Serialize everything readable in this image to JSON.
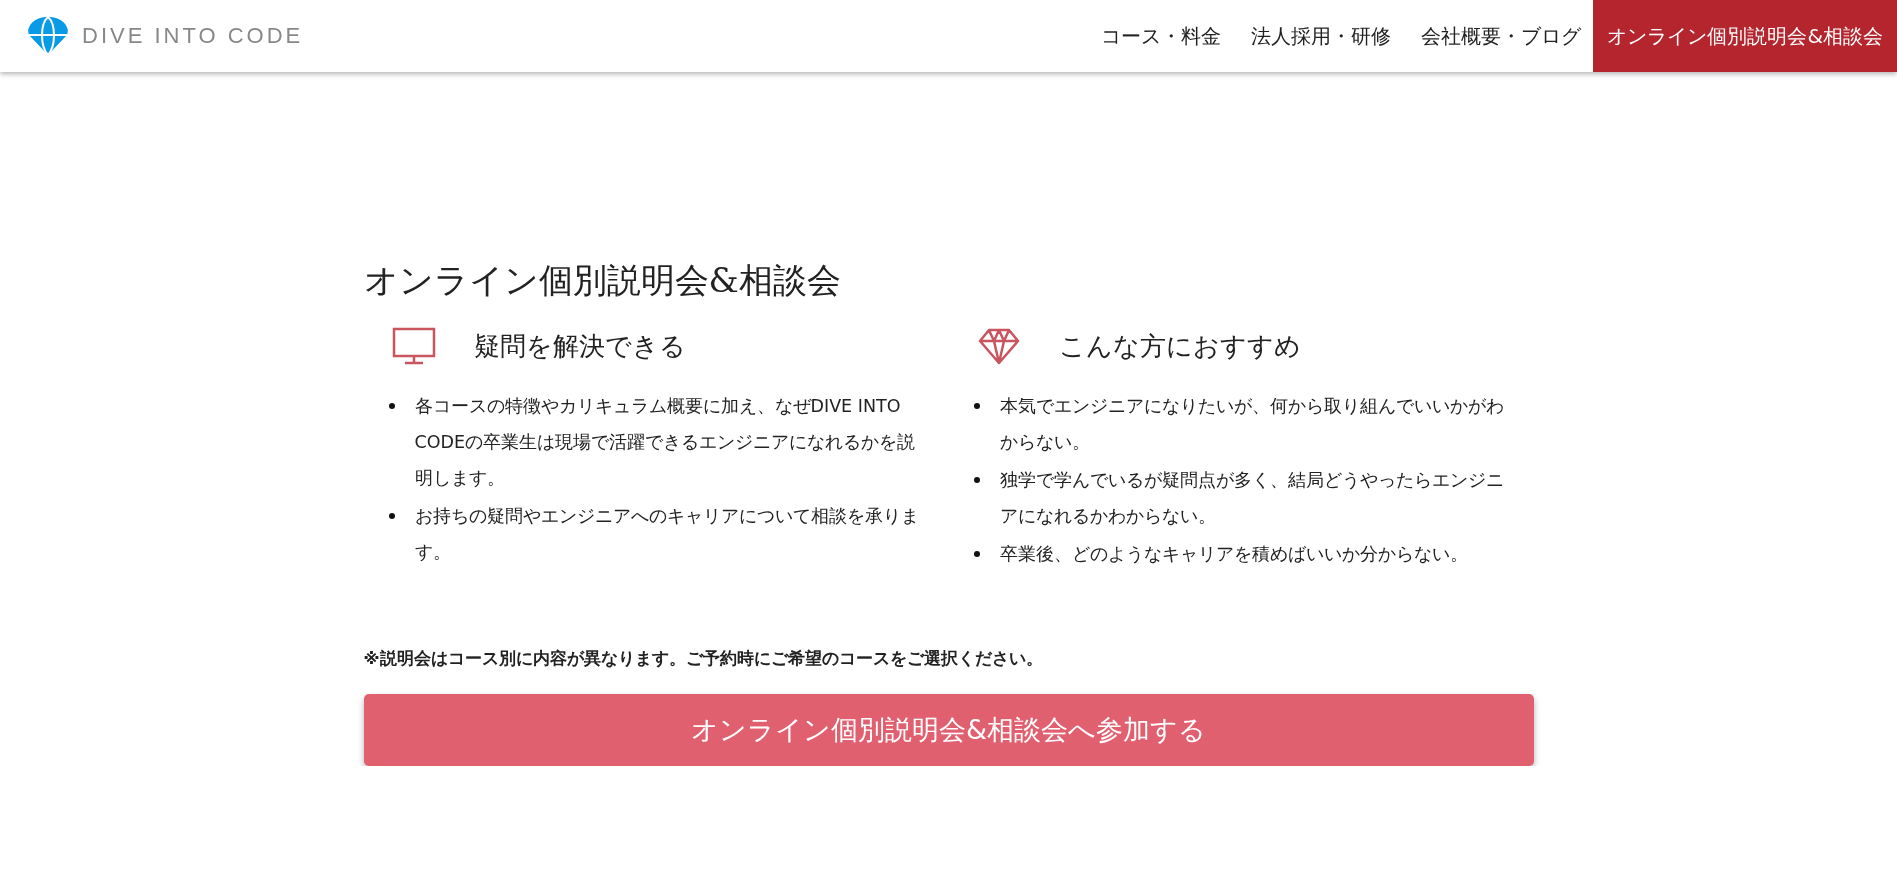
{
  "header": {
    "logo_text": "DIVE INTO CODE",
    "nav": [
      {
        "label": "コース・料金",
        "kind": "link"
      },
      {
        "label": "法人採用・研修",
        "kind": "link"
      },
      {
        "label": "会社概要・ブログ",
        "kind": "link"
      },
      {
        "label": "オンライン個別説明会&相談会",
        "kind": "cta"
      }
    ]
  },
  "section": {
    "title": "オンライン個別説明会&相談会",
    "columns": [
      {
        "kind": "monitor",
        "heading": "疑問を解決できる",
        "items": [
          "各コースの特徴やカリキュラム概要に加え、なぜDIVE INTO CODEの卒業生は現場で活躍できるエンジニアになれるかを説明します。",
          "お持ちの疑問やエンジニアへのキャリアについて相談を承ります。"
        ]
      },
      {
        "kind": "diamond",
        "heading": "こんな方におすすめ",
        "items": [
          "本気でエンジニアになりたいが、何から取り組んでいいかがわからない。",
          "独学で学んでいるが疑問点が多く、結局どうやったらエンジニアになれるかわからない。",
          "卒業後、どのようなキャリアを積めばいいか分からない。"
        ]
      }
    ],
    "note": "※説明会はコース別に内容が異なります。ご予約時にご希望のコースをご選択ください。",
    "button": "オンライン個別説明会&相談会へ参加する"
  }
}
